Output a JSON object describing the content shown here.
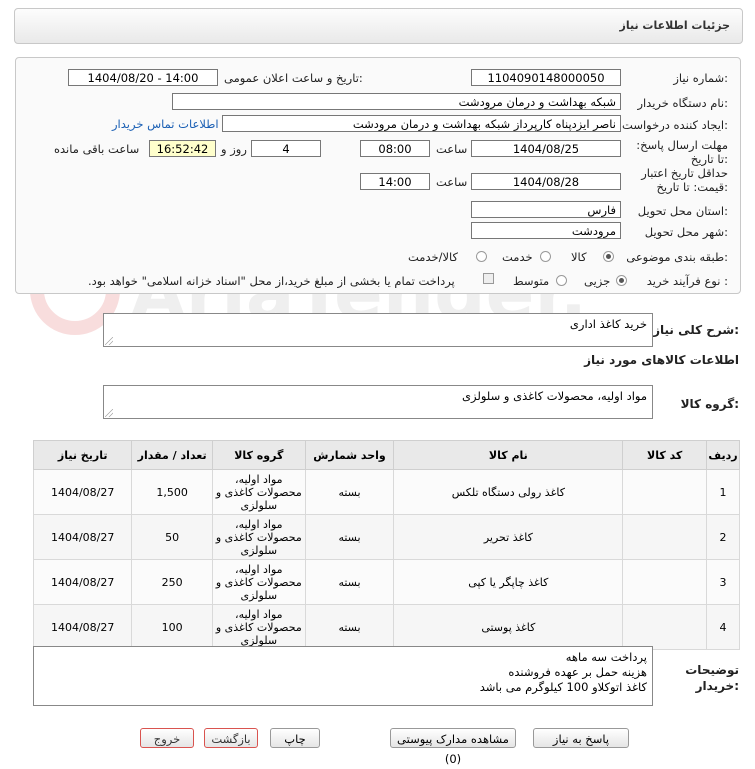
{
  "header": {
    "title": "جزئیات اطلاعات نیاز"
  },
  "form": {
    "need_number_label": "شماره نیاز:",
    "need_number": "1104090148000050",
    "announce_label": "تاریخ و ساعت اعلان عمومی:",
    "announce_value": "1404/08/20 - 14:00",
    "buyer_org_label": "نام دستگاه خریدار:",
    "buyer_org": "شبکه بهداشت و درمان مرودشت",
    "creator_label": "ایجاد کننده درخواست:",
    "creator": "ناصر ایزدپناه کارپرداز شبکه بهداشت و درمان مرودشت",
    "contact_link": "اطلاعات تماس خریدار",
    "deadline_label": "مهلت ارسال پاسخ: تا تاریخ:",
    "deadline_date": "1404/08/25",
    "time_label": "ساعت",
    "deadline_time": "08:00",
    "days_value": "4",
    "days_label": "روز و",
    "remaining_time": "16:52:42",
    "remaining_label": "ساعت باقی مانده",
    "validity_label": "حداقل تاریخ اعتبار قیمت: تا تاریخ:",
    "validity_date": "1404/08/28",
    "validity_time": "14:00",
    "province_label": "استان محل تحویل:",
    "province": "فارس",
    "city_label": "شهر محل تحویل:",
    "city": "مرودشت",
    "category_label": "طبقه بندی موضوعی:",
    "category_options": [
      "کالا",
      "خدمت",
      "کالا/خدمت"
    ],
    "category_selected": "کالا",
    "process_label": "نوع فرآیند خرید :",
    "process_options": [
      "جزیی",
      "متوسط"
    ],
    "process_selected": "جزیی",
    "payment_note": "پرداخت تمام یا بخشی از مبلغ خرید،از محل \"اسناد خزانه اسلامی\" خواهد بود."
  },
  "summary": {
    "label": "شرح کلی نیاز:",
    "value": "خرید کاغذ اداری"
  },
  "goods_info_title": "اطلاعات کالاهای مورد نیاز",
  "goods_group": {
    "label": "گروه کالا:",
    "value": "مواد اولیه، محصولات کاغذی و سلولزی"
  },
  "table": {
    "headers": [
      "ردیف",
      "کد کالا",
      "نام کالا",
      "واحد شمارش",
      "گروه کالا",
      "تعداد / مقدار",
      "تاریخ نیاز"
    ],
    "rows": [
      {
        "row": "1",
        "code": "",
        "name": "کاغذ رولی دستگاه تلکس",
        "unit": "بسته",
        "group": "مواد اولیه، محصولات کاغذی و سلولزی",
        "qty": "1,500",
        "date": "1404/08/27"
      },
      {
        "row": "2",
        "code": "",
        "name": "کاغذ تحریر",
        "unit": "بسته",
        "group": "مواد اولیه، محصولات کاغذی و سلولزی",
        "qty": "50",
        "date": "1404/08/27"
      },
      {
        "row": "3",
        "code": "",
        "name": "کاغذ چاپگر یا کپی",
        "unit": "بسته",
        "group": "مواد اولیه، محصولات کاغذی و سلولزی",
        "qty": "250",
        "date": "1404/08/27"
      },
      {
        "row": "4",
        "code": "",
        "name": "کاغذ پوستی",
        "unit": "بسته",
        "group": "مواد اولیه، محصولات کاغذی و سلولزی",
        "qty": "100",
        "date": "1404/08/27"
      }
    ]
  },
  "notes": {
    "label": "توضیحات خریدار:",
    "lines": [
      "پرداخت سه ماهه",
      "هزینه حمل بر عهده فروشنده",
      "کاغذ اتوکلاو 100 کیلوگرم می باشد"
    ]
  },
  "buttons": {
    "reply": "پاسخ به نیاز",
    "attachments": "مشاهده مدارک پیوستی (0)",
    "print": "چاپ",
    "back": "بازگشت",
    "exit": "خروج"
  },
  "watermark": "AriaTender.neT",
  "colors": {
    "link": "#1a5fb4",
    "highlight": "#ffffcc",
    "exit_border": "#d9534f"
  }
}
